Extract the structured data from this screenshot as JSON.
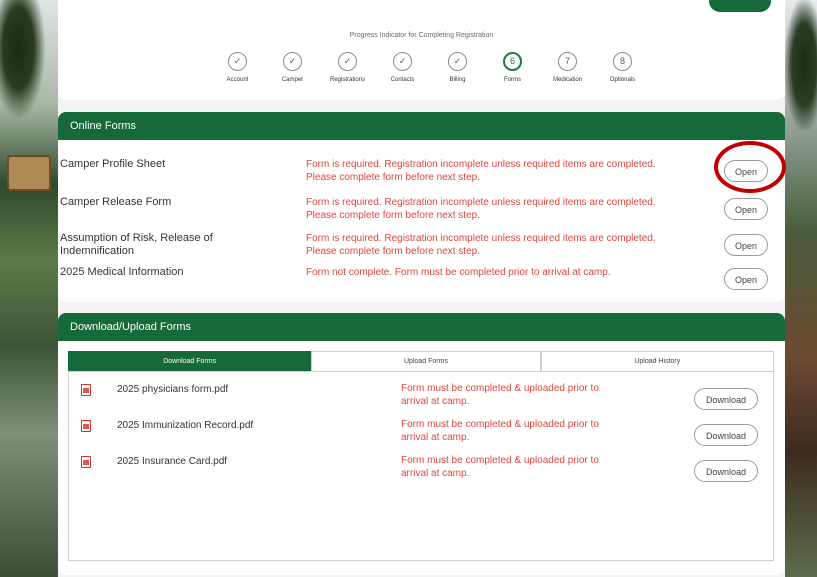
{
  "progress": {
    "title": "Progress Indicator for Completing Registration",
    "steps": [
      {
        "label": "Account",
        "mark": "✓"
      },
      {
        "label": "Camper",
        "mark": "✓"
      },
      {
        "label": "Registrations",
        "mark": "✓"
      },
      {
        "label": "Contacts",
        "mark": "✓"
      },
      {
        "label": "Billing",
        "mark": "✓"
      },
      {
        "label": "Forms",
        "mark": "6"
      },
      {
        "label": "Medication",
        "mark": "7"
      },
      {
        "label": "Optionals",
        "mark": "8"
      }
    ]
  },
  "online_forms": {
    "header": "Online Forms",
    "rows": [
      {
        "name": "Camper Profile Sheet",
        "status": "Form is required. Registration incomplete unless required items are completed. Please complete form before next step.",
        "button": "Open"
      },
      {
        "name": "Camper Release Form",
        "status": "Form is required. Registration incomplete unless required items are completed. Please complete form before next step.",
        "button": "Open"
      },
      {
        "name": "Assumption of Risk, Release of Indemnification",
        "status": "Form is required. Registration incomplete unless required items are completed. Please complete form before next step.",
        "button": "Open"
      },
      {
        "name": "2025 Medical Information",
        "status": "Form not complete. Form must be completed prior to arrival at camp.",
        "button": "Open"
      }
    ]
  },
  "downloads": {
    "header": "Download/Upload Forms",
    "tabs": [
      "Download Forms",
      "Upload Forms",
      "Upload History"
    ],
    "rows": [
      {
        "name": "2025 physicians form.pdf",
        "status": "Form must be completed & uploaded prior to arrival at camp.",
        "button": "Download"
      },
      {
        "name": "2025 Immunization Record.pdf",
        "status": "Form must be completed & uploaded prior to arrival at camp.",
        "button": "Download"
      },
      {
        "name": "2025 Insurance Card.pdf",
        "status": "Form must be completed & uploaded prior to arrival at camp.",
        "button": "Download"
      }
    ]
  },
  "colors": {
    "brand_green": "#15693a",
    "required_red": "#e0453f",
    "highlight_ring": "#c00000"
  }
}
